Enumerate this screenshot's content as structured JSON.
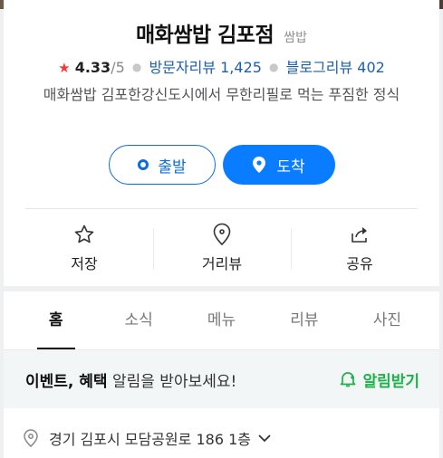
{
  "place": {
    "name": "매화쌈밥 김포점",
    "category": "쌈밥",
    "rating": "4.33",
    "rating_max": "/5",
    "visitor_reviews": "방문자리뷰 1,425",
    "blog_reviews": "블로그리뷰 402",
    "description": "매화쌈밥 김포한강신도시에서 무한리필로 먹는 푸짐한 정식"
  },
  "buttons": {
    "depart": "출발",
    "arrive": "도착"
  },
  "actions": {
    "save": "저장",
    "street_view": "거리뷰",
    "share": "공유"
  },
  "tabs": [
    "홈",
    "소식",
    "메뉴",
    "리뷰",
    "사진"
  ],
  "event": {
    "bold": "이벤트, 혜택",
    "rest": " 알림을 받아보세요!",
    "alarm": "알림받기"
  },
  "address": "경기 김포시 모담공원로 186 1층",
  "colors": {
    "primary_blue": "#0a7cff",
    "link_blue": "#1e5fa8",
    "green": "#1eb14a",
    "star_red": "#ee3c3c"
  }
}
